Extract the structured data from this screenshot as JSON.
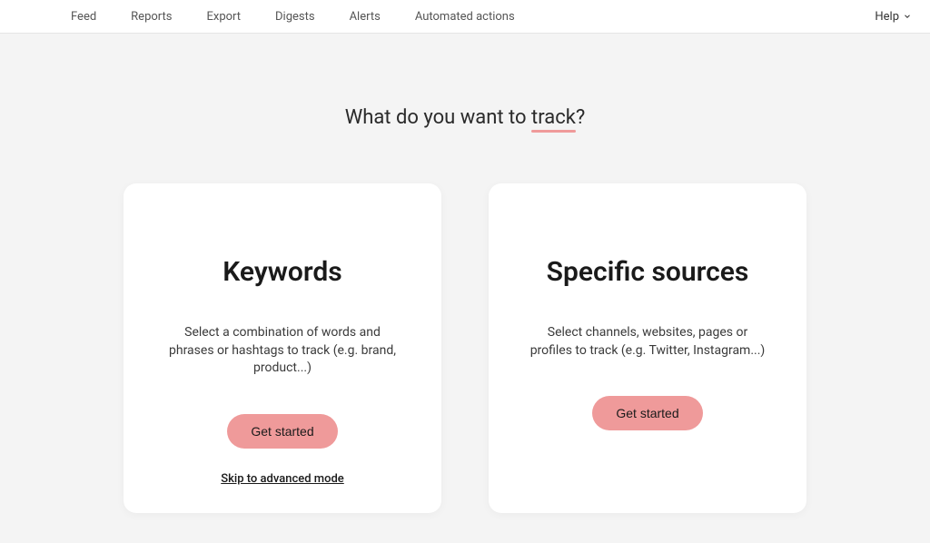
{
  "nav": {
    "items": [
      "Feed",
      "Reports",
      "Export",
      "Digests",
      "Alerts",
      "Automated actions"
    ],
    "help_label": "Help"
  },
  "heading": {
    "prefix": "What do you want to ",
    "highlight": "track",
    "suffix": "?"
  },
  "cards": {
    "keywords": {
      "title": "Keywords",
      "description": "Select a combination of words and phrases or hashtags to track (e.g. brand, product...)",
      "button": "Get started",
      "skip": "Skip to advanced mode"
    },
    "sources": {
      "title": "Specific sources",
      "description": "Select channels, websites, pages or profiles to track (e.g. Twitter, Instagram...)",
      "button": "Get started"
    }
  },
  "colors": {
    "accent": "#ef9a9a",
    "page_bg": "#f4f4f4",
    "card_bg": "#ffffff"
  }
}
